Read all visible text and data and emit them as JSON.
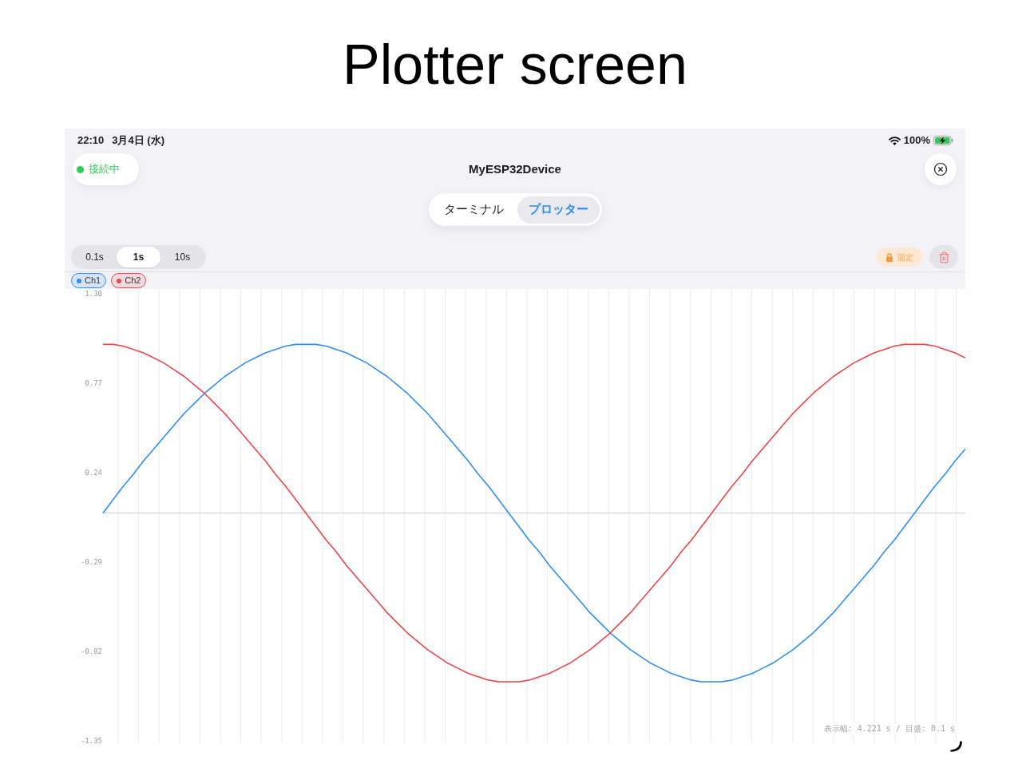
{
  "title": "Plotter screen",
  "status_bar": {
    "time": "22:10",
    "date": "3月4日 (水)",
    "battery": "100%"
  },
  "header": {
    "connection": {
      "label": "接続中",
      "connected": true
    },
    "device_name": "MyESP32Device"
  },
  "mode_tabs": [
    {
      "label": "ターミナル",
      "selected": false
    },
    {
      "label": "プロッター",
      "selected": true
    }
  ],
  "toolbar": {
    "time_ranges": [
      {
        "label": "0.1s",
        "selected": false
      },
      {
        "label": "1s",
        "selected": true
      },
      {
        "label": "10s",
        "selected": false
      }
    ],
    "lock_button": {
      "label": "固定"
    }
  },
  "plot": {
    "chart_data": {
      "type": "line",
      "categories": [
        null,
        null,
        null,
        null,
        null,
        null,
        null,
        null,
        null,
        null,
        null,
        null,
        null,
        null,
        null,
        null,
        null,
        null,
        null,
        null,
        null,
        null,
        null,
        null,
        null,
        null,
        null,
        null,
        null,
        null,
        null,
        null,
        null,
        null,
        null,
        null,
        null,
        null,
        null,
        null,
        null,
        null,
        null,
        null,
        null,
        null,
        null,
        null,
        null,
        null,
        null,
        null,
        null,
        null,
        null,
        null,
        null,
        null,
        null,
        null,
        null,
        null,
        null,
        null,
        null,
        null,
        null,
        null,
        null,
        null,
        null,
        null,
        null,
        null,
        null,
        null,
        null,
        null,
        null,
        null,
        null,
        null,
        null,
        null,
        null,
        null
      ],
      "series": [
        {
          "name": "Ch1",
          "color": "#2f8ff0",
          "values": [
            0,
            0.08,
            0.16,
            0.23,
            0.31,
            0.38,
            0.45,
            0.52,
            0.59,
            0.65,
            0.71,
            0.76,
            0.81,
            0.85,
            0.89,
            0.92,
            0.95,
            0.97,
            0.99,
            1,
            1,
            1,
            0.99,
            0.97,
            0.95,
            0.92,
            0.89,
            0.85,
            0.81,
            0.76,
            0.71,
            0.65,
            0.59,
            0.52,
            0.45,
            0.38,
            0.31,
            0.23,
            0.16,
            0.08,
            0,
            -0.08,
            -0.16,
            -0.23,
            -0.31,
            -0.38,
            -0.45,
            -0.52,
            -0.59,
            -0.65,
            -0.71,
            -0.76,
            -0.81,
            -0.85,
            -0.89,
            -0.92,
            -0.95,
            -0.97,
            -0.99,
            -1,
            -1,
            -1,
            -0.99,
            -0.97,
            -0.95,
            -0.92,
            -0.89,
            -0.85,
            -0.81,
            -0.76,
            -0.71,
            -0.65,
            -0.59,
            -0.52,
            -0.45,
            -0.38,
            -0.31,
            -0.23,
            -0.16,
            -0.08,
            0,
            0.08,
            0.16,
            0.23,
            0.31,
            0.38
          ]
        },
        {
          "name": "Ch2",
          "color": "#e8474c",
          "values": [
            1,
            1,
            0.99,
            0.97,
            0.95,
            0.92,
            0.89,
            0.85,
            0.81,
            0.76,
            0.71,
            0.65,
            0.59,
            0.52,
            0.45,
            0.38,
            0.31,
            0.23,
            0.16,
            0.08,
            0,
            -0.08,
            -0.16,
            -0.23,
            -0.31,
            -0.38,
            -0.45,
            -0.52,
            -0.59,
            -0.65,
            -0.71,
            -0.76,
            -0.81,
            -0.85,
            -0.89,
            -0.92,
            -0.95,
            -0.97,
            -0.99,
            -1,
            -1,
            -1,
            -0.99,
            -0.97,
            -0.95,
            -0.92,
            -0.89,
            -0.85,
            -0.81,
            -0.76,
            -0.71,
            -0.65,
            -0.59,
            -0.52,
            -0.45,
            -0.38,
            -0.31,
            -0.23,
            -0.16,
            -0.08,
            0,
            0.08,
            0.16,
            0.23,
            0.31,
            0.38,
            0.45,
            0.52,
            0.59,
            0.65,
            0.71,
            0.76,
            0.81,
            0.85,
            0.89,
            0.92,
            0.95,
            0.97,
            0.99,
            1,
            1,
            1,
            0.99,
            0.97,
            0.95,
            0.92
          ]
        }
      ],
      "ylim": [
        -1.35,
        1.3
      ],
      "yticks": [
        {
          "value": 1.3,
          "label": "1.30"
        },
        {
          "value": 0.77,
          "label": "0.77"
        },
        {
          "value": 0.24,
          "label": "0.24"
        },
        {
          "value": -0.29,
          "label": "-0.29"
        },
        {
          "value": -0.82,
          "label": "-0.82"
        },
        {
          "value": -1.35,
          "label": "-1.35"
        }
      ],
      "grid": true,
      "legend": "top-left"
    },
    "info": "表示幅: 4.221 s / 目盛: 0.1 s"
  }
}
